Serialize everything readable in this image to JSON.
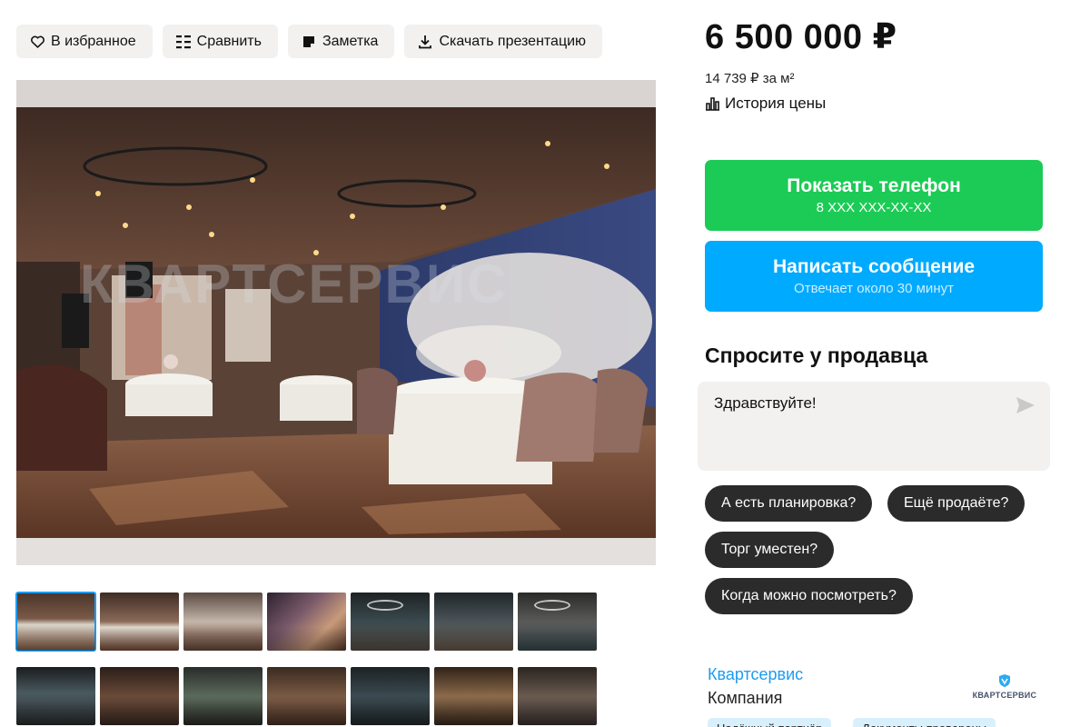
{
  "toolbar": {
    "favorites": "В избранное",
    "compare": "Сравнить",
    "note": "Заметка",
    "download": "Скачать презентацию"
  },
  "photo": {
    "watermark": "КВАРТСЕРВИС"
  },
  "listing": {
    "price": "6 500 000 ₽",
    "price_per_m2": "14 739 ₽ за м²",
    "price_history": "История цены"
  },
  "contact": {
    "show_phone": "Показать телефон",
    "phone_masked": "8 XXX XXX-XX-XX",
    "write_message": "Написать сообщение",
    "reply_time": "Отвечает около 30 минут"
  },
  "ask": {
    "title": "Спросите у продавца",
    "message": "Здравствуйте!",
    "chips": [
      "А есть планировка?",
      "Ещё продаёте?",
      "Торг уместен?",
      "Когда можно посмотреть?"
    ]
  },
  "seller": {
    "name": "Квартсервис",
    "type": "Компания",
    "logo_text": "КВАРТСЕРВИС",
    "badges": [
      "Надёжный партнёр",
      "Документы проверены"
    ]
  },
  "colors": {
    "phone_button": "#1ccb55",
    "message_button": "#00aaff",
    "link": "#1e9bf0",
    "chip": "#2b2b2b"
  }
}
